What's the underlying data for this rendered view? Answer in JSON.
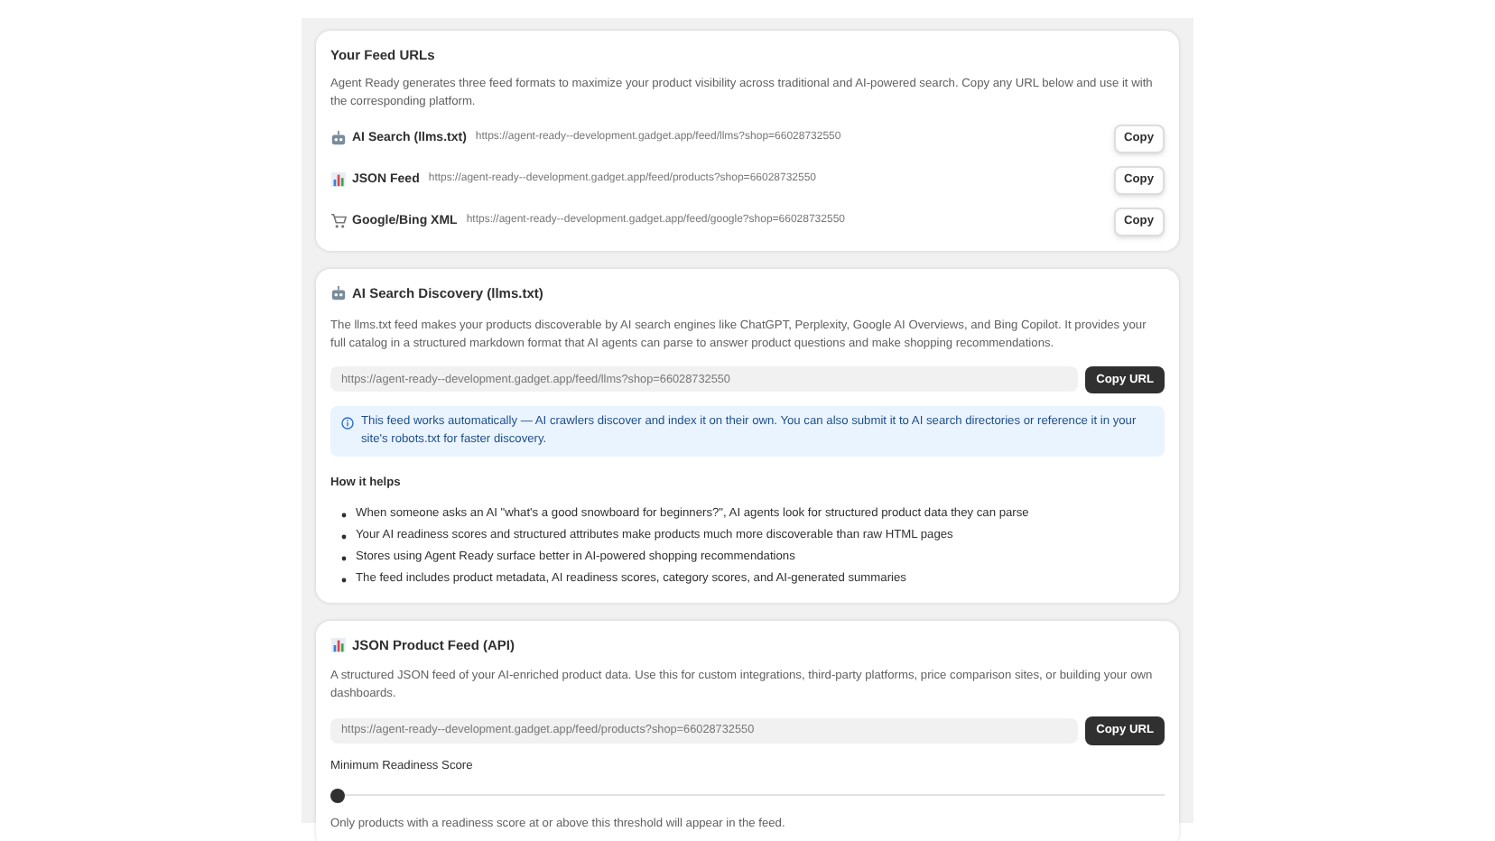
{
  "feed_urls": {
    "title": "Your Feed URLs",
    "description": "Agent Ready generates three feed formats to maximize your product visibility across traditional and AI-powered search. Copy any URL below and use it with the corresponding platform.",
    "feeds": [
      {
        "kind": "robot",
        "label": "AI Search (llms.txt)",
        "url": "https://agent-ready--development.gadget.app/feed/llms?shop=66028732550",
        "button": "Copy"
      },
      {
        "kind": "chart",
        "label": "JSON Feed",
        "url": "https://agent-ready--development.gadget.app/feed/products?shop=66028732550",
        "button": "Copy"
      },
      {
        "kind": "cart",
        "label": "Google/Bing XML",
        "url": "https://agent-ready--development.gadget.app/feed/google?shop=66028732550",
        "button": "Copy"
      }
    ]
  },
  "discovery": {
    "kind": "robot",
    "title": "AI Search Discovery (llms.txt)",
    "description": "The llms.txt feed makes your products discoverable by AI search engines like ChatGPT, Perplexity, Google AI Overviews, and Bing Copilot. It provides your full catalog in a structured markdown format that AI agents can parse to answer product questions and make shopping recommendations.",
    "url": "https://agent-ready--development.gadget.app/feed/llms?shop=66028732550",
    "button": "Copy URL",
    "info": "This feed works automatically — AI crawlers discover and index it on their own. You can also submit it to AI search directories or reference it in your site's robots.txt for faster discovery.",
    "helps_title": "How it helps",
    "helps": [
      "When someone asks an AI \"what's a good snowboard for beginners?\", AI agents look for structured product data they can parse",
      "Your AI readiness scores and structured attributes make products much more discoverable than raw HTML pages",
      "Stores using Agent Ready surface better in AI-powered shopping recommendations",
      "The feed includes product metadata, AI readiness scores, category scores, and AI-generated summaries"
    ]
  },
  "json_feed": {
    "kind": "chart",
    "title": "JSON Product Feed (API)",
    "description": "A structured JSON feed of your AI-enriched product data. Use this for custom integrations, third-party platforms, price comparison sites, or building your own dashboards.",
    "url": "https://agent-ready--development.gadget.app/feed/products?shop=66028732550",
    "button": "Copy URL",
    "slider_label": "Minimum Readiness Score",
    "level": 0,
    "hint": "Only products with a readiness score at or above this threshold will appear in the feed."
  }
}
